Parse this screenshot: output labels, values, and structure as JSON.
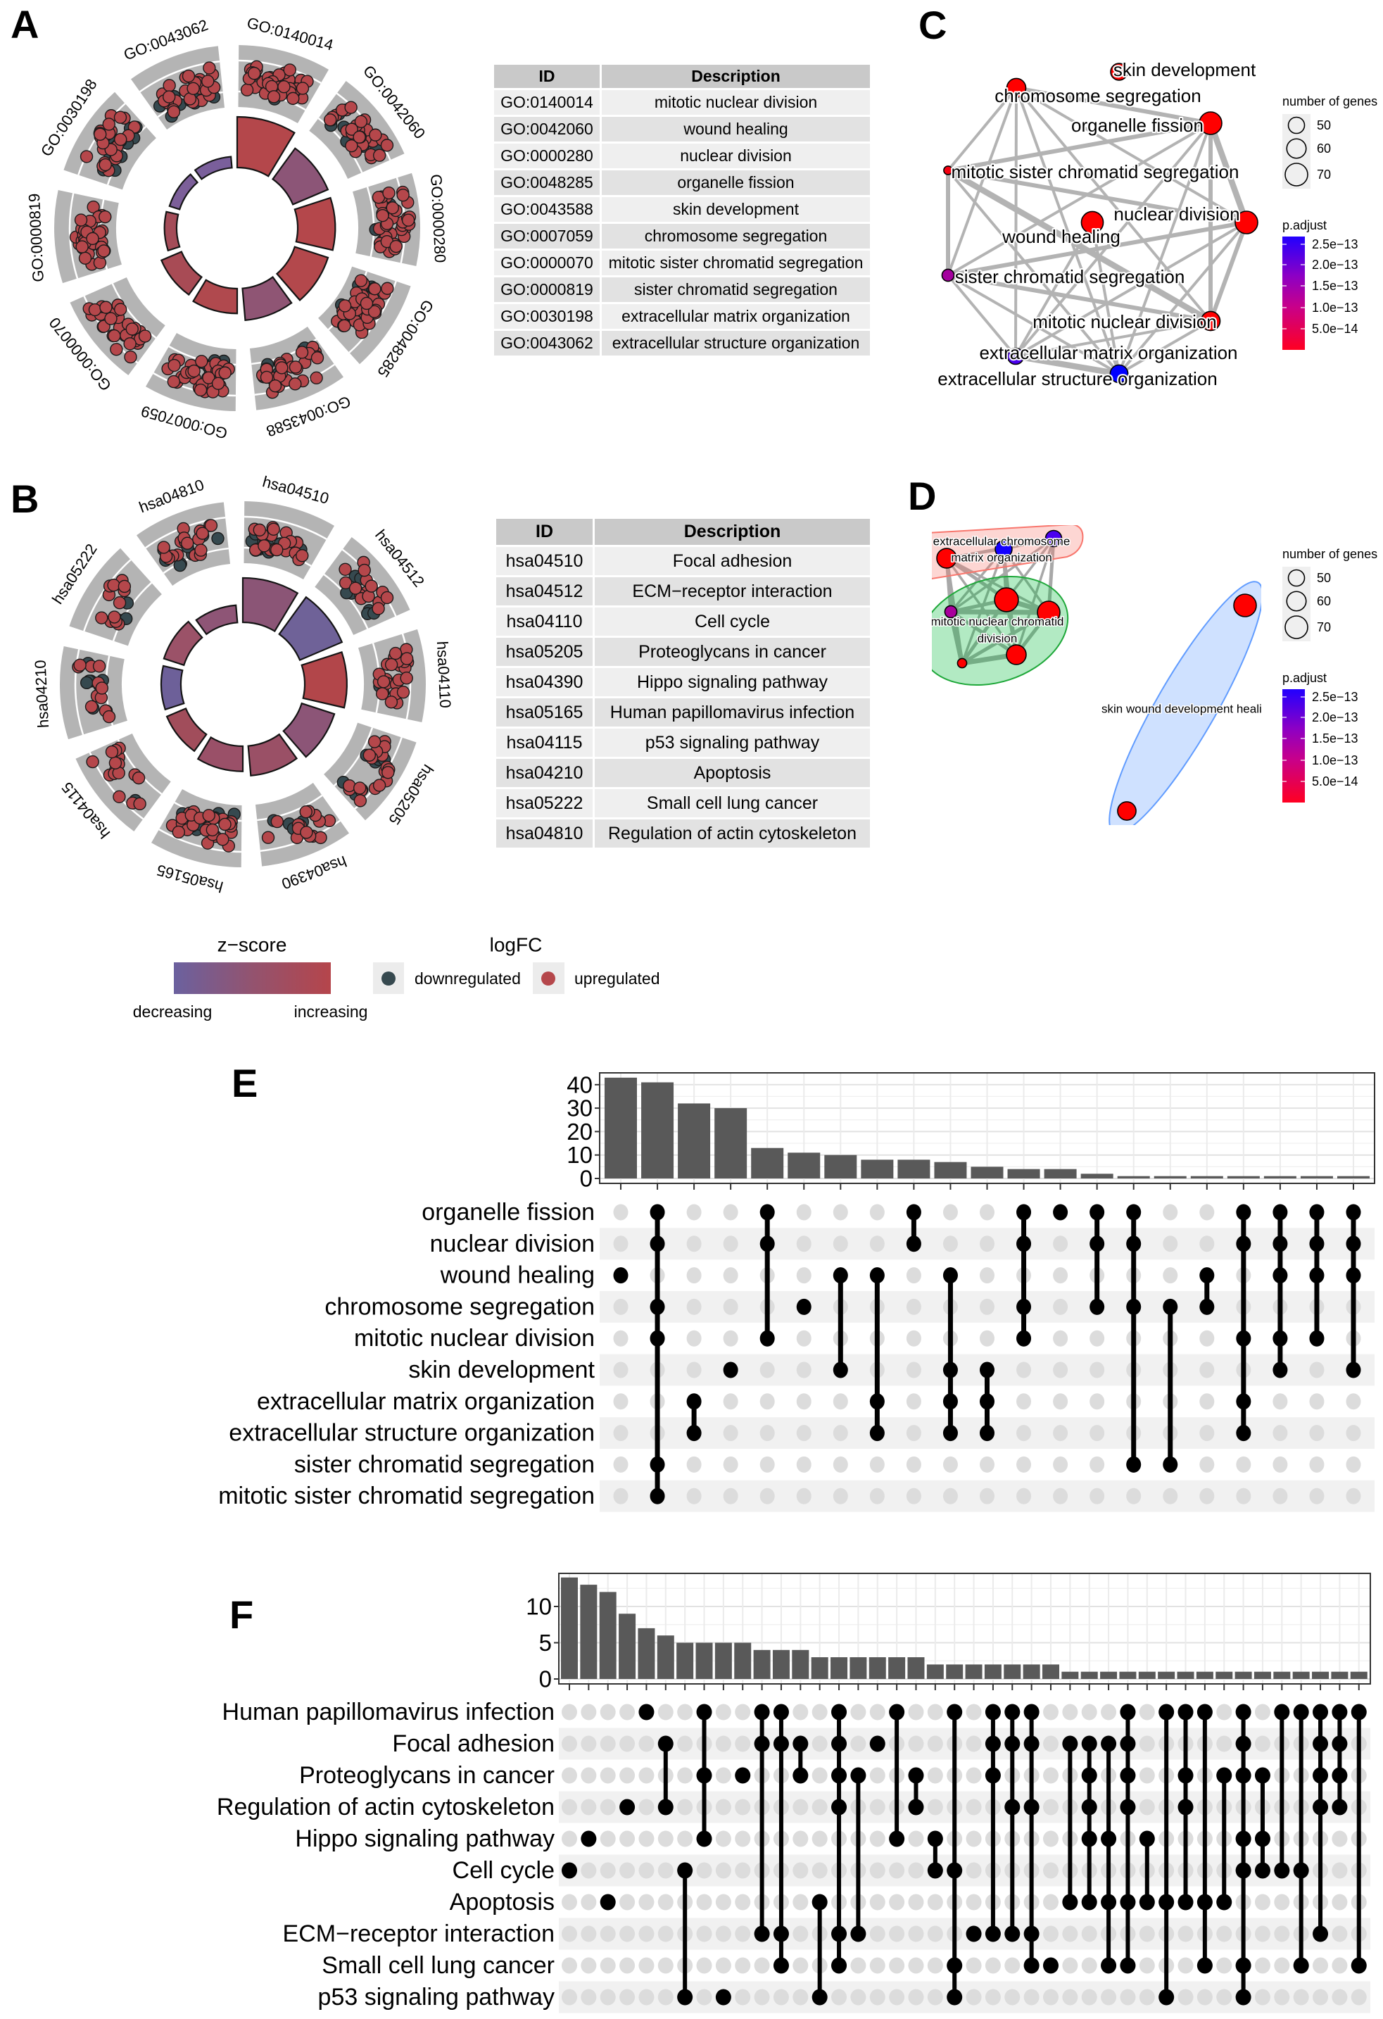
{
  "figure": {
    "panel_labels": {
      "a": "A",
      "b": "B",
      "c": "C",
      "d": "D",
      "e": "E",
      "f": "F"
    }
  },
  "gocircle_legend": {
    "zscore_title": "z−score",
    "zscore_low_label": "decreasing",
    "zscore_high_label": "increasing",
    "zscore_low_color": "#6b619f",
    "zscore_high_color": "#b5454b",
    "logfc_title": "logFC",
    "down_label": "downregulated",
    "up_label": "upregulated",
    "down_color": "#36494f",
    "up_color": "#b5474b"
  },
  "chart_data": [
    {
      "panel": "A",
      "type": "bar",
      "subtype": "GOCircle (inner z-score bars, outer logFC gene scatter)",
      "table_columns": [
        "ID",
        "Description"
      ],
      "categories": [
        "GO:0140014",
        "GO:0042060",
        "GO:0000280",
        "GO:0048285",
        "GO:0043588",
        "GO:0007059",
        "GO:0000070",
        "GO:0000819",
        "GO:0030198",
        "GO:0043062"
      ],
      "descriptions": [
        "mitotic nuclear division",
        "wound healing",
        "nuclear division",
        "organelle fission",
        "skin development",
        "chromosome segregation",
        "mitotic sister chromatid segregation",
        "sister chromatid segregation",
        "extracellular matrix organization",
        "extracellular structure organization"
      ],
      "bar_relative_height": [
        1.0,
        0.75,
        0.74,
        0.69,
        0.63,
        0.49,
        0.43,
        0.24,
        0.21,
        0.22
      ],
      "zscore_colors": [
        "#b4474b",
        "#8c5577",
        "#b4474b",
        "#b3484c",
        "#8f5574",
        "#b0494e",
        "#a84b55",
        "#a44c58",
        "#7c5f99",
        "#7a5f9b"
      ],
      "genes_up": [
        40,
        30,
        40,
        40,
        28,
        35,
        30,
        34,
        26,
        26
      ],
      "genes_down": [
        3,
        10,
        4,
        5,
        8,
        5,
        1,
        1,
        10,
        10
      ]
    },
    {
      "panel": "B",
      "type": "bar",
      "subtype": "GOCircle (inner z-score bars, outer logFC gene scatter)",
      "table_columns": [
        "ID",
        "Description"
      ],
      "categories": [
        "hsa04510",
        "hsa04512",
        "hsa04110",
        "hsa05205",
        "hsa04390",
        "hsa05165",
        "hsa04115",
        "hsa04210",
        "hsa05222",
        "hsa04810"
      ],
      "descriptions": [
        "Focal adhesion",
        "ECM−receptor interaction",
        "Cell cycle",
        "Proteoglycans in cancer",
        "Hippo signaling pathway",
        "Human papillomavirus infection",
        "p53 signaling pathway",
        "Apoptosis",
        "Small cell lung cancer",
        "Regulation of actin cytoskeleton"
      ],
      "bar_relative_height": [
        0.97,
        1.0,
        0.92,
        0.75,
        0.65,
        0.55,
        0.45,
        0.43,
        0.46,
        0.38
      ],
      "zscore_colors": [
        "#8b5576",
        "#6f6298",
        "#b2464a",
        "#8c5577",
        "#9a5066",
        "#9a5068",
        "#a14d5b",
        "#6d6099",
        "#9b5268",
        "#8e5576"
      ],
      "genes_up": [
        20,
        15,
        26,
        20,
        15,
        26,
        16,
        12,
        12,
        18
      ],
      "genes_down": [
        12,
        8,
        1,
        8,
        4,
        12,
        1,
        7,
        3,
        8
      ]
    },
    {
      "panel": "C",
      "type": "scatter",
      "subtype": "enrichment map network",
      "nodes": [
        {
          "name": "skin development",
          "genes": 52,
          "color": "#ff0000"
        },
        {
          "name": "chromosome segregation",
          "genes": 59,
          "color": "#ff0000"
        },
        {
          "name": "organelle fission",
          "genes": 70,
          "color": "#ff0000"
        },
        {
          "name": "mitotic sister chromatid segregation",
          "genes": 26,
          "color": "#f50010"
        },
        {
          "name": "wound healing",
          "genes": 68,
          "color": "#ff0000"
        },
        {
          "name": "nuclear division",
          "genes": 70,
          "color": "#ff0000"
        },
        {
          "name": "sister chromatid segregation",
          "genes": 37,
          "color": "#a4009e"
        },
        {
          "name": "mitotic nuclear division",
          "genes": 59,
          "color": "#ff0000"
        },
        {
          "name": "extracellular matrix organization",
          "genes": 50,
          "color": "#4a00ee"
        },
        {
          "name": "extracellular structure organization",
          "genes": 55,
          "color": "#0000ff"
        }
      ],
      "edges": [
        [
          1,
          2,
          2
        ],
        [
          1,
          3,
          1
        ],
        [
          1,
          6,
          1
        ],
        [
          1,
          8,
          1
        ],
        [
          1,
          5,
          1
        ],
        [
          1,
          7,
          1
        ],
        [
          1,
          9,
          1
        ],
        [
          2,
          3,
          2
        ],
        [
          2,
          5,
          3
        ],
        [
          2,
          7,
          2
        ],
        [
          2,
          6,
          1
        ],
        [
          2,
          8,
          1
        ],
        [
          2,
          9,
          1
        ],
        [
          3,
          6,
          2
        ],
        [
          3,
          5,
          2
        ],
        [
          3,
          7,
          3
        ],
        [
          3,
          9,
          1
        ],
        [
          4,
          8,
          1
        ],
        [
          4,
          9,
          1
        ],
        [
          5,
          6,
          2
        ],
        [
          5,
          7,
          2
        ],
        [
          5,
          8,
          1
        ],
        [
          5,
          9,
          1
        ],
        [
          6,
          7,
          2
        ],
        [
          6,
          9,
          1
        ],
        [
          6,
          8,
          1
        ],
        [
          7,
          8,
          1
        ],
        [
          7,
          9,
          1
        ],
        [
          8,
          9,
          3
        ]
      ],
      "legend": {
        "size_title": "number of genes",
        "size_breaks": [
          "50",
          "60",
          "70"
        ],
        "size_values": [
          50,
          60,
          70
        ],
        "color_title": "p.adjust",
        "color_breaks": [
          "2.5e−13",
          "2.0e−13",
          "1.5e−13",
          "1.0e−13",
          "5.0e−14"
        ],
        "color_high": "#2200ff",
        "color_low": "#ff0022"
      }
    },
    {
      "panel": "D",
      "type": "scatter",
      "subtype": "clustered enrichment map network",
      "clusters": [
        {
          "label_lines": [
            "extracellular chromosome",
            "matrix organization"
          ],
          "fill": "rgba(248,118,109,0.30)",
          "stroke": "#f8766d"
        },
        {
          "label_lines": [
            "mitotic nuclear chromatid",
            "division"
          ],
          "fill": "rgba(0,186,56,0.30)",
          "stroke": "#1fa83a"
        },
        {
          "label_lines": [
            "skin wound development heali"
          ],
          "fill": "rgba(97,156,255,0.30)",
          "stroke": "#619cff"
        }
      ],
      "nodes": [
        {
          "cluster": 0,
          "genes": 61,
          "color": "#ff0000"
        },
        {
          "cluster": 0,
          "genes": 52,
          "color": "#1400ff"
        },
        {
          "cluster": 0,
          "genes": 50,
          "color": "#4a00f0"
        },
        {
          "cluster": 1,
          "genes": 74,
          "color": "#ff0000"
        },
        {
          "cluster": 1,
          "genes": 37,
          "color": "#a8009c"
        },
        {
          "cluster": 1,
          "genes": 70,
          "color": "#ff0000"
        },
        {
          "cluster": 1,
          "genes": 61,
          "color": "#ff0000"
        },
        {
          "cluster": 1,
          "genes": 28,
          "color": "#ff0000"
        },
        {
          "cluster": 2,
          "genes": 70,
          "color": "#ff0000"
        },
        {
          "cluster": 2,
          "genes": 57,
          "color": "#ff0000"
        }
      ],
      "edges": [
        [
          0,
          1,
          1
        ],
        [
          0,
          2,
          1
        ],
        [
          1,
          2,
          1
        ],
        [
          0,
          3,
          2
        ],
        [
          0,
          4,
          2
        ],
        [
          0,
          5,
          1
        ],
        [
          0,
          6,
          1
        ],
        [
          0,
          7,
          2
        ],
        [
          1,
          3,
          2
        ],
        [
          1,
          4,
          1
        ],
        [
          1,
          5,
          1
        ],
        [
          1,
          6,
          1
        ],
        [
          1,
          7,
          1
        ],
        [
          2,
          3,
          1
        ],
        [
          2,
          4,
          1
        ],
        [
          2,
          5,
          2
        ],
        [
          2,
          6,
          1
        ],
        [
          3,
          4,
          2
        ],
        [
          3,
          5,
          3
        ],
        [
          3,
          6,
          2
        ],
        [
          3,
          7,
          2
        ],
        [
          4,
          5,
          3
        ],
        [
          4,
          6,
          2
        ],
        [
          4,
          7,
          3
        ],
        [
          5,
          6,
          2
        ],
        [
          5,
          7,
          2
        ],
        [
          6,
          7,
          3
        ]
      ],
      "legend": {
        "size_title": "number of genes",
        "size_breaks": [
          "50",
          "60",
          "70"
        ],
        "size_values": [
          50,
          60,
          70
        ],
        "color_title": "p.adjust",
        "color_breaks": [
          "2.5e−13",
          "2.0e−13",
          "1.5e−13",
          "1.0e−13",
          "5.0e−14"
        ],
        "color_high": "#2200ff",
        "color_low": "#ff0022"
      }
    },
    {
      "panel": "E",
      "type": "bar",
      "subtype": "UpSet plot",
      "sets": [
        "organelle fission",
        "nuclear division",
        "wound healing",
        "chromosome segregation",
        "mitotic nuclear division",
        "skin development",
        "extracellular matrix organization",
        "extracellular structure organization",
        "sister chromatid segregation",
        "mitotic sister chromatid segregation"
      ],
      "intersections": [
        {
          "members": [
            2
          ],
          "size": 43
        },
        {
          "members": [
            0,
            1,
            3,
            4,
            8,
            9
          ],
          "size": 41
        },
        {
          "members": [
            6,
            7
          ],
          "size": 32
        },
        {
          "members": [
            5
          ],
          "size": 30
        },
        {
          "members": [
            0,
            1,
            4
          ],
          "size": 13
        },
        {
          "members": [
            3
          ],
          "size": 11
        },
        {
          "members": [
            2,
            5
          ],
          "size": 10
        },
        {
          "members": [
            2,
            6,
            7
          ],
          "size": 8
        },
        {
          "members": [
            0,
            1
          ],
          "size": 8
        },
        {
          "members": [
            2,
            5,
            6,
            7
          ],
          "size": 7
        },
        {
          "members": [
            5,
            6,
            7
          ],
          "size": 5
        },
        {
          "members": [
            0,
            1,
            3,
            4
          ],
          "size": 4
        },
        {
          "members": [
            0
          ],
          "size": 4
        },
        {
          "members": [
            0,
            1,
            3
          ],
          "size": 2
        },
        {
          "members": [
            0,
            1,
            3,
            8
          ],
          "size": 1
        },
        {
          "members": [
            3,
            8
          ],
          "size": 1
        },
        {
          "members": [
            2,
            3
          ],
          "size": 1
        },
        {
          "members": [
            0,
            1,
            4,
            6,
            7
          ],
          "size": 1
        },
        {
          "members": [
            0,
            1,
            2,
            4,
            5
          ],
          "size": 1
        },
        {
          "members": [
            0,
            1,
            2,
            4
          ],
          "size": 1
        },
        {
          "members": [
            0,
            1,
            2,
            5
          ],
          "size": 1
        }
      ],
      "ylim": [
        0,
        45
      ],
      "yticks": [
        0,
        10,
        20,
        30,
        40
      ],
      "ytick_labels": [
        "0",
        "10",
        "20",
        "30",
        "40"
      ],
      "grid": true
    },
    {
      "panel": "F",
      "type": "bar",
      "subtype": "UpSet plot",
      "sets": [
        "Human papillomavirus infection",
        "Focal adhesion",
        "Proteoglycans in cancer",
        "Regulation of actin cytoskeleton",
        "Hippo signaling pathway",
        "Cell cycle",
        "Apoptosis",
        "ECM−receptor interaction",
        "Small cell lung cancer",
        "p53 signaling pathway"
      ],
      "intersections": [
        {
          "members": [
            5
          ],
          "size": 14
        },
        {
          "members": [
            4
          ],
          "size": 13
        },
        {
          "members": [
            6
          ],
          "size": 12
        },
        {
          "members": [
            3
          ],
          "size": 9
        },
        {
          "members": [
            0
          ],
          "size": 7
        },
        {
          "members": [
            1,
            3
          ],
          "size": 6
        },
        {
          "members": [
            5,
            9
          ],
          "size": 5
        },
        {
          "members": [
            0,
            2,
            4
          ],
          "size": 5
        },
        {
          "members": [
            9
          ],
          "size": 5
        },
        {
          "members": [
            2
          ],
          "size": 5
        },
        {
          "members": [
            0,
            1,
            7
          ],
          "size": 4
        },
        {
          "members": [
            0,
            1,
            7,
            8
          ],
          "size": 4
        },
        {
          "members": [
            1,
            2
          ],
          "size": 4
        },
        {
          "members": [
            6,
            9
          ],
          "size": 3
        },
        {
          "members": [
            0,
            1,
            2,
            3,
            7,
            8
          ],
          "size": 3
        },
        {
          "members": [
            2,
            7
          ],
          "size": 3
        },
        {
          "members": [
            1
          ],
          "size": 3
        },
        {
          "members": [
            0,
            4
          ],
          "size": 3
        },
        {
          "members": [
            2,
            3
          ],
          "size": 3
        },
        {
          "members": [
            4,
            5
          ],
          "size": 2
        },
        {
          "members": [
            0,
            5,
            8,
            9
          ],
          "size": 2
        },
        {
          "members": [
            7
          ],
          "size": 2
        },
        {
          "members": [
            0,
            1,
            2,
            7
          ],
          "size": 2
        },
        {
          "members": [
            0,
            1,
            3,
            7
          ],
          "size": 2
        },
        {
          "members": [
            0,
            1,
            3,
            7,
            8
          ],
          "size": 2
        },
        {
          "members": [
            8
          ],
          "size": 2
        },
        {
          "members": [
            1,
            6
          ],
          "size": 1
        },
        {
          "members": [
            1,
            2,
            3,
            4,
            6
          ],
          "size": 1
        },
        {
          "members": [
            1,
            4,
            6,
            8
          ],
          "size": 1
        },
        {
          "members": [
            0,
            1,
            2,
            3,
            6,
            8
          ],
          "size": 1
        },
        {
          "members": [
            4,
            6
          ],
          "size": 1
        },
        {
          "members": [
            0,
            6,
            9
          ],
          "size": 1
        },
        {
          "members": [
            0,
            2,
            3,
            6
          ],
          "size": 1
        },
        {
          "members": [
            0,
            6,
            8
          ],
          "size": 1
        },
        {
          "members": [
            2,
            6
          ],
          "size": 1
        },
        {
          "members": [
            0,
            1,
            2,
            4,
            5,
            8,
            9
          ],
          "size": 1
        },
        {
          "members": [
            2,
            4,
            5
          ],
          "size": 1
        },
        {
          "members": [
            0,
            5
          ],
          "size": 1
        },
        {
          "members": [
            0,
            5,
            8
          ],
          "size": 1
        },
        {
          "members": [
            0,
            1,
            2,
            3,
            7
          ],
          "size": 1
        },
        {
          "members": [
            0,
            1,
            2,
            3
          ],
          "size": 1
        },
        {
          "members": [
            0,
            8
          ],
          "size": 1
        }
      ],
      "ylim": [
        0,
        14.5
      ],
      "yticks": [
        0,
        5,
        10
      ],
      "ytick_labels": [
        "0",
        "5",
        "10"
      ],
      "grid": true
    }
  ]
}
